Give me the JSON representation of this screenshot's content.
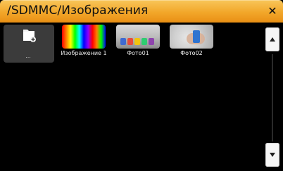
{
  "window": {
    "title": "/SDMMC/Изображения",
    "close_label": "✕",
    "colors": {
      "titlebar_accent": "#f2a72a",
      "background": "#000000",
      "selection": "#3b3b3b"
    }
  },
  "icons": {
    "close": "close-icon",
    "folder": "folder-icon",
    "scroll_up": "scroll-up-icon",
    "scroll_down": "scroll-down-icon"
  },
  "files": [
    {
      "label": "...",
      "type": "folder"
    },
    {
      "label": "Изображение 1",
      "type": "image"
    },
    {
      "label": "Фото01",
      "type": "image"
    },
    {
      "label": "Фото02",
      "type": "image"
    }
  ]
}
